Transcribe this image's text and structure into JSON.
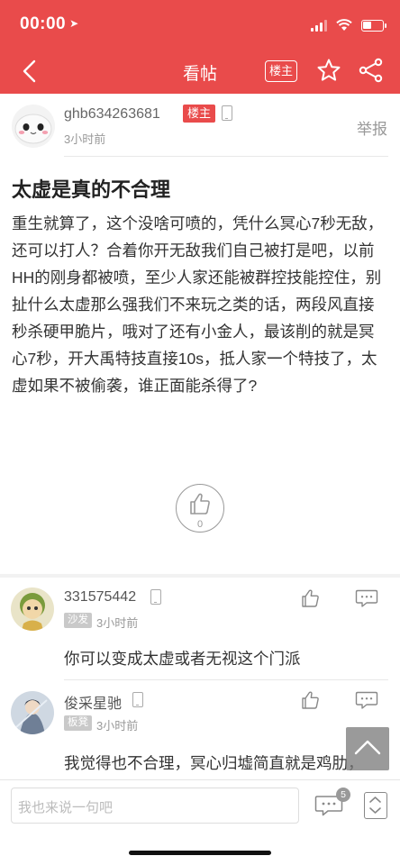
{
  "status_bar": {
    "time": "00:00",
    "location_arrow": "➤"
  },
  "nav": {
    "title": "看帖",
    "louzhu_label": "楼主",
    "icons": [
      "back-chevron-icon",
      "star-icon",
      "share-icon"
    ]
  },
  "post": {
    "author": "ghb634263681",
    "op_badge": "楼主",
    "time": "3小时前",
    "report": "举报",
    "title": "太虚是真的不合理",
    "body": "重生就算了，这个没啥可喷的，凭什么冥心7秒无敌，还可以打人？合着你开无敌我们自己被打是吧，以前HH的刚身都被喷，至少人家还能被群控技能控住，别扯什么太虚那么强我们不来玩之类的话，两段风直接秒杀硬甲脆片，哦对了还有小金人，最该削的就是冥心7秒，开大禹特技直接10s，抵人家一个特技了，太虚如果不被偷袭，谁正面能杀得了?",
    "likes": "0"
  },
  "comments": [
    {
      "author": "331575442",
      "badge": "沙发",
      "time": "3小时前",
      "text": "你可以变成太虚或者无视这个门派"
    },
    {
      "author": "俊采星驰",
      "badge": "板凳",
      "time": "3小时前",
      "text": "我觉得也不合理，冥心归墟简直就是鸡肋，"
    }
  ],
  "bottom_bar": {
    "placeholder": "我也来说一句吧",
    "comment_count": "5"
  },
  "colors": {
    "accent": "#e94b4b"
  }
}
